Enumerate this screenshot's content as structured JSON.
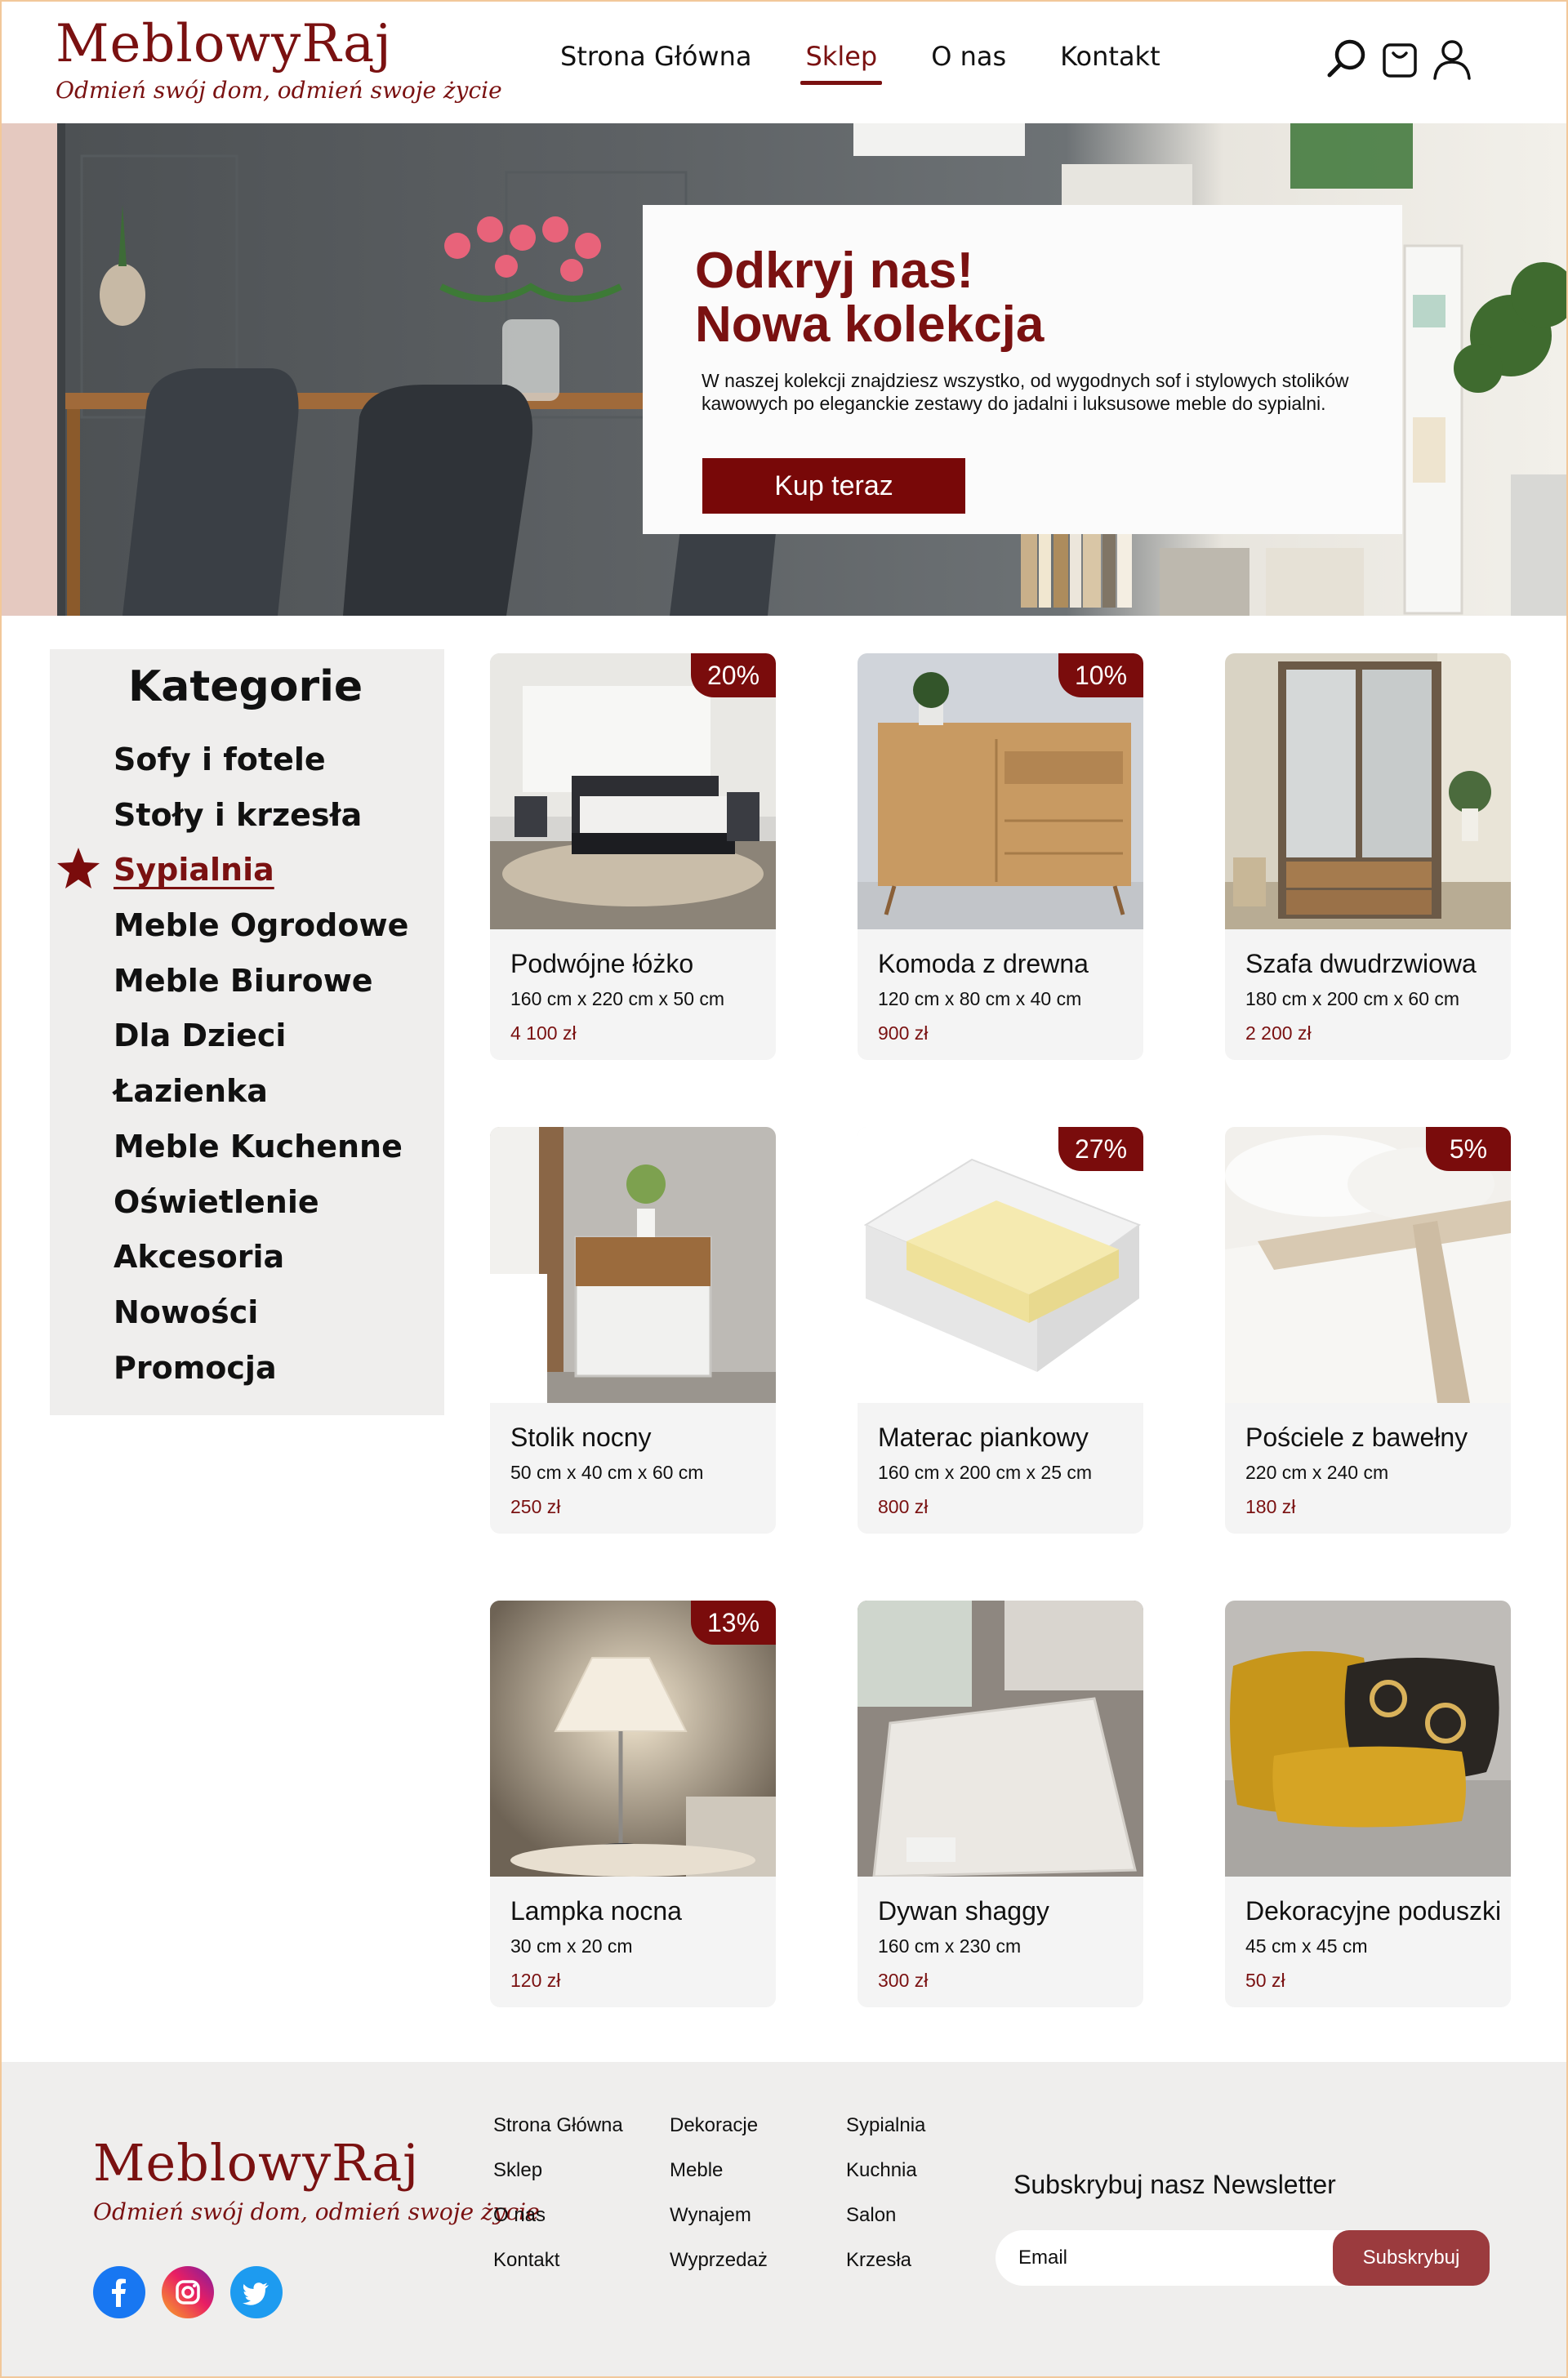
{
  "brand": {
    "name": "MeblowyRaj",
    "tagline": "Odmień swój dom, odmień swoje życie",
    "color": "#7a1111"
  },
  "nav": {
    "items": [
      {
        "label": "Strona Główna"
      },
      {
        "label": "Sklep",
        "active": true
      },
      {
        "label": "O nas"
      },
      {
        "label": "Kontakt"
      }
    ],
    "icons": [
      "search-icon",
      "cart-icon",
      "user-icon"
    ]
  },
  "hero": {
    "title_line1": "Odkryj nas!",
    "title_line2": "Nowa kolekcja",
    "text": "W naszej kolekcji znajdziesz wszystko, od wygodnych sof i stylowych stolików kawowych po eleganckie zestawy do jadalni i luksusowe meble do sypialni.",
    "button": "Kup teraz"
  },
  "sidebar": {
    "title": "Kategorie",
    "active_index": 2,
    "items": [
      "Sofy i fotele",
      "Stoły i krzesła",
      "Sypialnia",
      "Meble Ogrodowe",
      "Meble Biurowe",
      "Dla Dzieci",
      "Łazienka",
      "Meble Kuchenne",
      "Oświetlenie",
      "Akcesoria",
      "Nowości",
      "Promocja"
    ]
  },
  "products": [
    {
      "name": "Podwójne łóżko",
      "dims": "160 cm x 220 cm x 50 cm",
      "price": "4 100 zł",
      "discount": "20%"
    },
    {
      "name": "Komoda z drewna",
      "dims": "120 cm x 80 cm x 40 cm",
      "price": "900 zł",
      "discount": "10%"
    },
    {
      "name": "Szafa dwudrzwiowa",
      "dims": "180 cm x 200 cm x 60 cm",
      "price": "2 200 zł",
      "discount": ""
    },
    {
      "name": "Stolik nocny",
      "dims": "50 cm x 40 cm x 60 cm",
      "price": "250 zł",
      "discount": ""
    },
    {
      "name": "Materac piankowy",
      "dims": "160 cm x 200 cm x 25 cm",
      "price": "800 zł",
      "discount": "27%"
    },
    {
      "name": "Pościele z bawełny",
      "dims": "220 cm x 240 cm",
      "price": "180 zł",
      "discount": "5%"
    },
    {
      "name": "Lampka nocna",
      "dims": "30 cm x 20 cm",
      "price": "120 zł",
      "discount": "13%"
    },
    {
      "name": "Dywan shaggy",
      "dims": "160 cm x 230 cm",
      "price": "300 zł",
      "discount": ""
    },
    {
      "name": "Dekoracyjne poduszki",
      "dims": "45 cm x 45 cm",
      "price": "50 zł",
      "discount": ""
    }
  ],
  "footer": {
    "columns": [
      [
        "Strona Główna",
        "Sklep",
        "O nas",
        "Kontakt"
      ],
      [
        "Dekoracje",
        "Meble",
        "Wynajem",
        "Wyprzedaż"
      ],
      [
        "Sypialnia",
        "Kuchnia",
        "Salon",
        "Krzesła"
      ]
    ],
    "social": [
      "facebook-icon",
      "instagram-icon",
      "twitter-icon"
    ],
    "newsletter": {
      "title": "Subskrybuj nasz Newsletter",
      "placeholder": "Email",
      "button": "Subskrybuj"
    }
  }
}
